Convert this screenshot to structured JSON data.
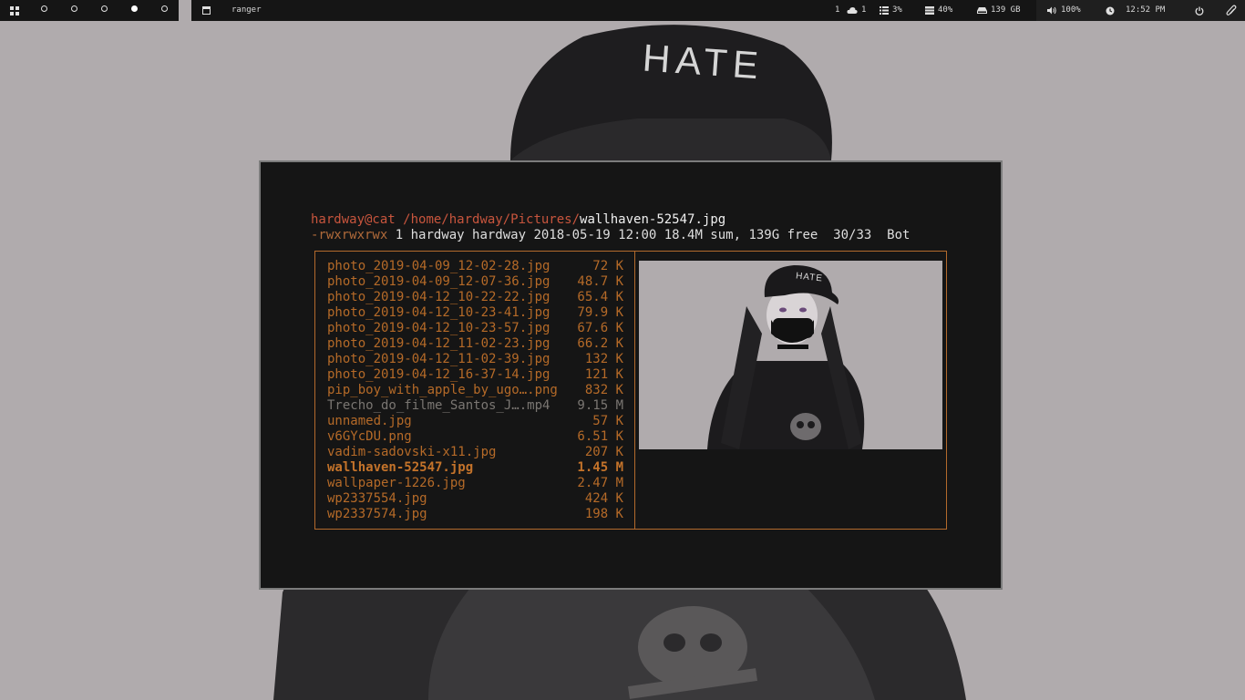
{
  "topbar": {
    "window_title": "ranger",
    "updates": "1",
    "uploads": "1",
    "cpu": "3%",
    "memory": "40%",
    "disk": "139 GB",
    "volume": "100%",
    "clock": "12:52 PM"
  },
  "terminal": {
    "prompt_user": "hardway@cat",
    "prompt_dir": "/home/hardway/Pictures/",
    "prompt_file": "wallhaven-52547.jpg",
    "permissions": "-rwxrwxrwx",
    "status_info": " 1 hardway hardway 2018-05-19 12:00 18.4M sum, 139G free  30/33  Bot"
  },
  "files": [
    {
      "name": "photo_2019-04-09_12-02-28.jpg",
      "size": "72 K"
    },
    {
      "name": "photo_2019-04-09_12-07-36.jpg",
      "size": "48.7 K"
    },
    {
      "name": "photo_2019-04-12_10-22-22.jpg",
      "size": "65.4 K"
    },
    {
      "name": "photo_2019-04-12_10-23-41.jpg",
      "size": "79.9 K"
    },
    {
      "name": "photo_2019-04-12_10-23-57.jpg",
      "size": "67.6 K"
    },
    {
      "name": "photo_2019-04-12_11-02-23.jpg",
      "size": "66.2 K"
    },
    {
      "name": "photo_2019-04-12_11-02-39.jpg",
      "size": "132 K"
    },
    {
      "name": "photo_2019-04-12_16-37-14.jpg",
      "size": "121 K"
    },
    {
      "name": "pip_boy_with_apple_by_ugo….png",
      "size": "832 K"
    },
    {
      "name": "Trecho_do_filme_Santos_J….mp4",
      "size": "9.15 M"
    },
    {
      "name": "unnamed.jpg",
      "size": "57 K"
    },
    {
      "name": "v6GYcDU.png",
      "size": "6.51 K"
    },
    {
      "name": "vadim-sadovski-x11.jpg",
      "size": "207 K"
    },
    {
      "name": "wallhaven-52547.jpg",
      "size": "1.45 M"
    },
    {
      "name": "wallpaper-1226.jpg",
      "size": "2.47 M"
    },
    {
      "name": "wp2337554.jpg",
      "size": "424 K"
    },
    {
      "name": "wp2337574.jpg",
      "size": "198 K"
    }
  ],
  "wallpaper_text": "HATE",
  "preview_text": "HATE",
  "colors": {
    "background": "#b0abad",
    "terminal_bg": "#151515",
    "accent_orange": "#b56a28",
    "prompt_red": "#c8553d",
    "bar_bg": "#151515"
  }
}
